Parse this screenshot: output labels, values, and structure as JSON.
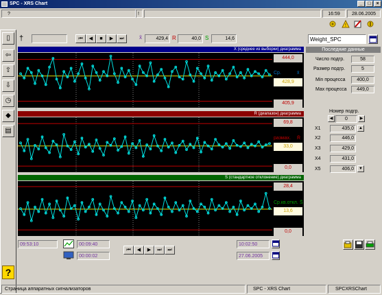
{
  "window": {
    "title": "SPC - XRS Chart",
    "buttons": [
      "_",
      "□",
      "×"
    ]
  },
  "topbar": {
    "help_glyph": "?",
    "warn_glyph": "!",
    "time": "16:59",
    "date": "28.06.2005"
  },
  "toolbar": {
    "value_x": "429,4",
    "value_r": "40,0",
    "value_s": "14,6",
    "label_x": "x̄",
    "label_r": "R",
    "label_s": "S",
    "weight_title": "Weight_SPC"
  },
  "charts": {
    "x_header": "X (среднее из выборки) диаграмма",
    "r_header": "R (диапазон) диаграмма",
    "s_header": "S (стандартное отклонение) диаграмма",
    "x_ucl": "444,0",
    "x_mean": "428,9",
    "x_lcl": "405,9",
    "x_mean_label": "Ср.",
    "x_symbol": "x̄",
    "r_ucl": "69,8",
    "r_mean": "33,0",
    "r_lcl": "0,0",
    "r_mean_label": "размах.",
    "r_symbol": "R̄",
    "s_ucl": "28,4",
    "s_mean": "13,6",
    "s_lcl": "0,0",
    "s_mean_label": "Ср.кв.откл.",
    "s_symbol": "S̄"
  },
  "chart_data": [
    {
      "type": "line",
      "title": "X (среднее из выборки) диаграмма",
      "ucl": 444.0,
      "center": 428.9,
      "lcl": 405.9,
      "ylim": [
        400,
        450
      ],
      "values": [
        431,
        427,
        436,
        432,
        422,
        434,
        429,
        421,
        437,
        445,
        426,
        418,
        433,
        428,
        436,
        424,
        431,
        440,
        427,
        417,
        438,
        432,
        425,
        433,
        429,
        447,
        431,
        423,
        436,
        428,
        434,
        426,
        421,
        438,
        432,
        429,
        441,
        424,
        430,
        435,
        427,
        419,
        433,
        437,
        428,
        426,
        442,
        430,
        424,
        436,
        431,
        427,
        438,
        425,
        432,
        429,
        434,
        426,
        431,
        437,
        428,
        432,
        427,
        435,
        429,
        433,
        431,
        428,
        434,
        430
      ]
    },
    {
      "type": "line",
      "title": "R (диапазон) диаграмма",
      "ucl": 69.8,
      "center": 33.0,
      "lcl": 0.0,
      "ylim": [
        -10,
        80
      ],
      "values": [
        38,
        25,
        44,
        12,
        34,
        28,
        48,
        30,
        22,
        41,
        35,
        15,
        52,
        33,
        27,
        40,
        20,
        46,
        31,
        36,
        24,
        43,
        29,
        18,
        39,
        34,
        45,
        26,
        32,
        48,
        21,
        37,
        30,
        42,
        16,
        35,
        28,
        50,
        33,
        25,
        44,
        31,
        38,
        22,
        34,
        41,
        27,
        36,
        30,
        46,
        23,
        39,
        33,
        28,
        44,
        35,
        31,
        37,
        29,
        42,
        34,
        32,
        38,
        30,
        36,
        33,
        40,
        31,
        35,
        37
      ]
    },
    {
      "type": "line",
      "title": "S (стандартное отклонение) диаграмма",
      "ucl": 28.4,
      "center": 13.6,
      "lcl": 0.0,
      "ylim": [
        -4,
        32
      ],
      "values": [
        14,
        10,
        18,
        6,
        15,
        12,
        20,
        11,
        17,
        8,
        19,
        13,
        9,
        21,
        14,
        16,
        7,
        18,
        12,
        15,
        20,
        10,
        17,
        13,
        9,
        22,
        14,
        11,
        18,
        15,
        12,
        19,
        8,
        16,
        13,
        20,
        11,
        17,
        14,
        10,
        21,
        15,
        12,
        18,
        13,
        16,
        9,
        19,
        14,
        12,
        17,
        15,
        11,
        20,
        13,
        16,
        14,
        18,
        12,
        15,
        10,
        19,
        13,
        16,
        14,
        17,
        12,
        15,
        24,
        14
      ]
    }
  ],
  "right_panel": {
    "title": "Последние данные",
    "count_label": "Число подгр.",
    "count_value": "58",
    "size_label": "Размер подгр.",
    "size_value": "5",
    "min_label": "Min процесса",
    "min_value": "400,0",
    "max_label": "Max процесса",
    "max_value": "449,0",
    "group_label": "Номер подгр.",
    "group_value": "0",
    "x1_label": "X1",
    "x1_value": "435,0",
    "x2_label": "X2",
    "x2_value": "446,0",
    "x3_label": "X3",
    "x3_value": "429,0",
    "x4_label": "X4",
    "x4_value": "431,0",
    "x5_label": "X5",
    "x5_value": "406,0"
  },
  "bottom": {
    "time_start": "09:53:10",
    "duration1": "00:09:40",
    "duration2": "00:00:02",
    "time_end": "10:02:50",
    "date_end": "27.06.2005"
  },
  "statusbar": {
    "left": "Страница аппаратных сигнализаторов",
    "middle": "SPC - XRS Chart",
    "right": "SPCXRSChart"
  },
  "colors": {
    "x_header": "#00008b",
    "r_header": "#8b0000",
    "s_header": "#006400",
    "data_line": "#00e0e0",
    "center_line": "#e0e000",
    "limit_line": "#c00000"
  }
}
